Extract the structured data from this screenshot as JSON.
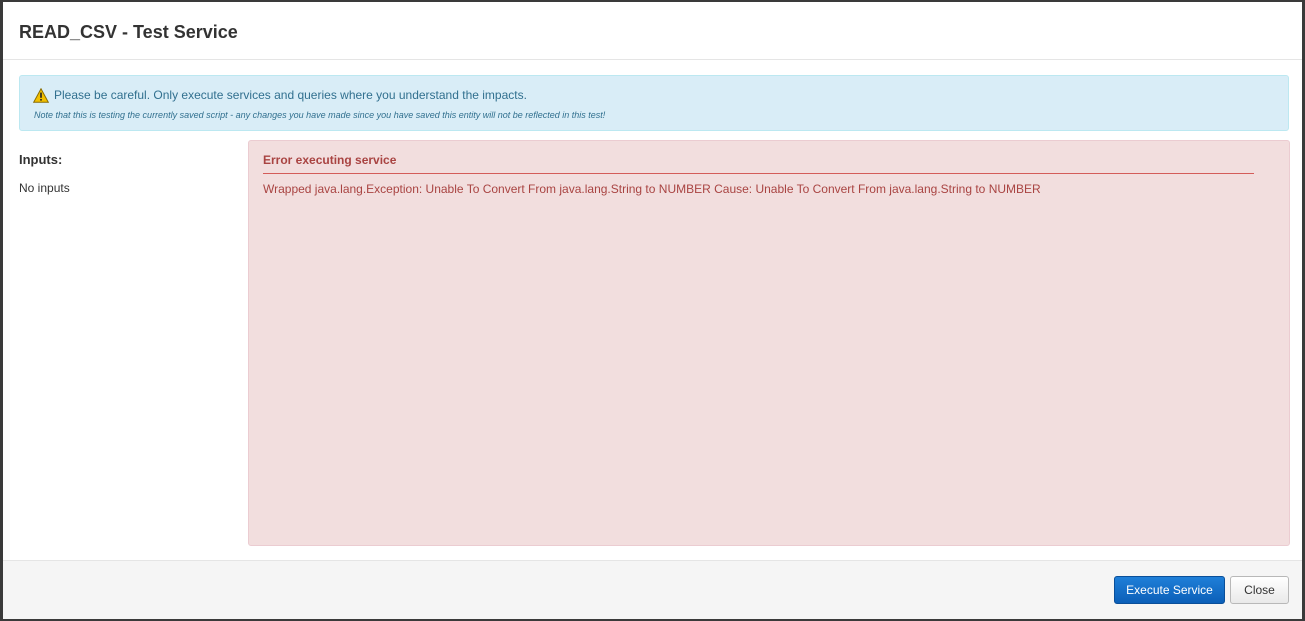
{
  "dialog": {
    "title": "READ_CSV - Test Service"
  },
  "alert": {
    "icon": "warning-icon",
    "message": "Please be careful. Only execute services and queries where you understand the impacts.",
    "note": "Note that this is testing the currently saved script - any changes you have made since you have saved this entity will not be reflected in this test!",
    "background_color": "#d9edf7",
    "text_color": "#31708f"
  },
  "inputs": {
    "heading": "Inputs:",
    "empty_text": "No inputs"
  },
  "result": {
    "title": "Error executing service",
    "message": "Wrapped java.lang.Exception: Unable To Convert From java.lang.String to NUMBER Cause: Unable To Convert From java.lang.String to NUMBER",
    "background_color": "#f2dede",
    "text_color": "#a94442"
  },
  "footer": {
    "execute_label": "Execute Service",
    "close_label": "Close",
    "primary_color": "#0b62c4"
  }
}
